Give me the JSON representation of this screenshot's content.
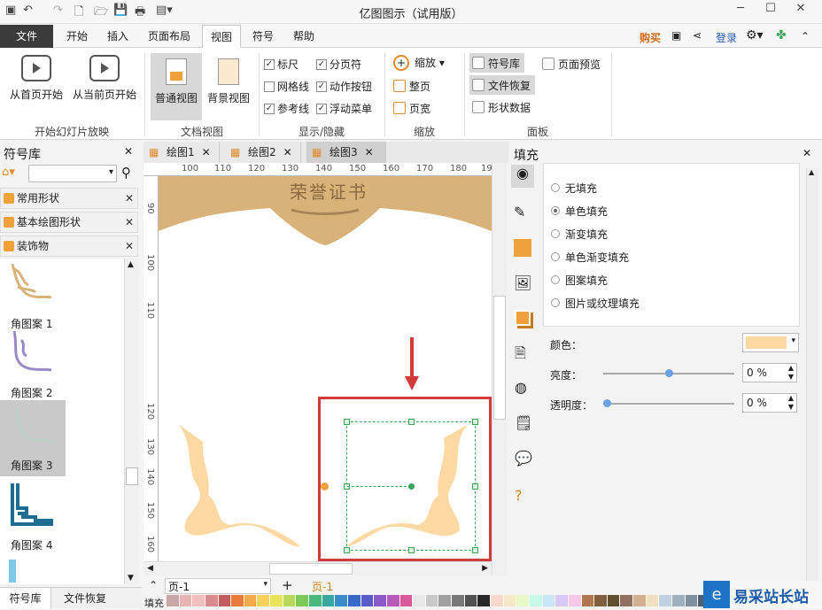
{
  "window": {
    "title": "亿图图示（试用版）"
  },
  "menu": {
    "file": "文件",
    "tabs": [
      "开始",
      "插入",
      "页面布局",
      "视图",
      "符号",
      "帮助"
    ],
    "active_tab": "视图",
    "right": {
      "buy": "购买",
      "login": "登录"
    }
  },
  "ribbon": {
    "slideshow": {
      "from_first": "从首页开始",
      "from_current": "从当前页开始",
      "label": "开始幻灯片放映"
    },
    "docview": {
      "normal": "普通视图",
      "background": "背景视图",
      "label": "文档视图"
    },
    "showhide": {
      "ruler": "标尺",
      "pagebreak": "分页符",
      "grid": "网格线",
      "action": "动作按钮",
      "guides": "参考线",
      "floating": "浮动菜单",
      "label": "显示/隐藏"
    },
    "zoom": {
      "zoom": "缩放",
      "whole": "整页",
      "width": "页宽",
      "label": "缩放"
    },
    "panels": {
      "library": "符号库",
      "recover": "文件恢复",
      "shapedata": "形状数据",
      "preview": "页面预览",
      "label": "面板"
    }
  },
  "library": {
    "title": "符号库",
    "categories": [
      "常用形状",
      "基本绘图形状",
      "装饰物"
    ],
    "symbols": [
      "角图案 1",
      "角图案 2",
      "角图案 3",
      "角图案 4"
    ],
    "bottom_tabs": [
      "符号库",
      "文件恢复"
    ]
  },
  "documents": {
    "tabs": [
      "绘图1",
      "绘图2",
      "绘图3"
    ],
    "active": "绘图3",
    "ruler_top": [
      "100",
      "110",
      "120",
      "130",
      "140",
      "150",
      "160",
      "170",
      "180",
      "190"
    ],
    "ruler_left": [
      "90",
      "100",
      "110",
      "120",
      "130",
      "140",
      "150",
      "160"
    ]
  },
  "canvas": {
    "banner_text": "荣誉证书"
  },
  "pagebar": {
    "page_select": "页-1",
    "page_tab": "页-1",
    "palette_label": "填充"
  },
  "fill_panel": {
    "title": "填充",
    "options": [
      "无填充",
      "单色填充",
      "渐变填充",
      "单色渐变填充",
      "图案填充",
      "图片或纹理填充"
    ],
    "selected": "单色填充",
    "color_label": "颜色：",
    "color_value": "#fcd9a3",
    "brightness_label": "亮度：",
    "brightness": "0 %",
    "brightness_level": 0.5,
    "transparency_label": "透明度：",
    "transparency": "0 %",
    "transparency_level": 0.0
  },
  "watermark": {
    "text": "易采站长站"
  },
  "colors": {
    "ornament": "#fcd9a3",
    "banner": "#d9b27a",
    "highlight": "#d23b3b",
    "selection": "#3aa65a"
  }
}
